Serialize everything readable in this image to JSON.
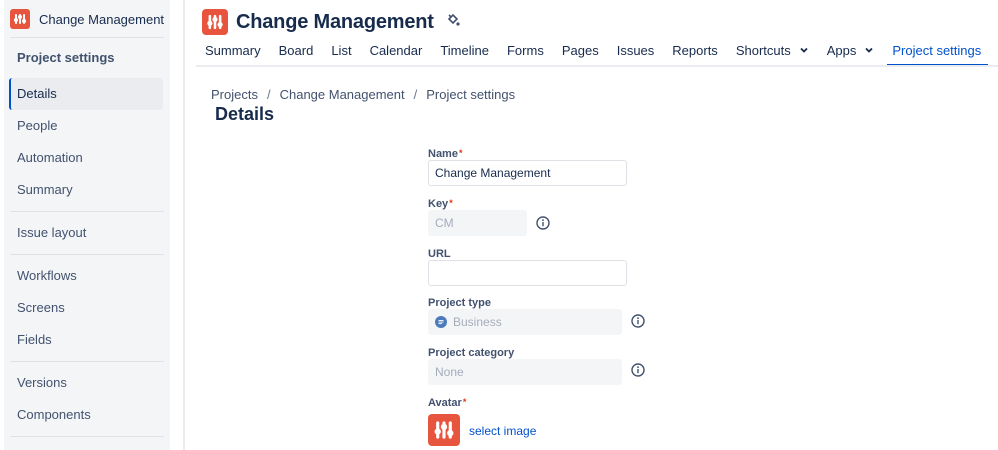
{
  "sidebar": {
    "project_name": "Change Management",
    "heading": "Project settings",
    "items": [
      {
        "label": "Details"
      },
      {
        "label": "People"
      },
      {
        "label": "Automation"
      },
      {
        "label": "Summary"
      },
      {
        "label": "Issue layout"
      },
      {
        "label": "Workflows"
      },
      {
        "label": "Screens"
      },
      {
        "label": "Fields"
      },
      {
        "label": "Versions"
      },
      {
        "label": "Components"
      }
    ]
  },
  "header": {
    "title": "Change Management",
    "tabs": [
      {
        "label": "Summary"
      },
      {
        "label": "Board"
      },
      {
        "label": "List"
      },
      {
        "label": "Calendar"
      },
      {
        "label": "Timeline"
      },
      {
        "label": "Forms"
      },
      {
        "label": "Pages"
      },
      {
        "label": "Issues"
      },
      {
        "label": "Reports"
      },
      {
        "label": "Shortcuts"
      },
      {
        "label": "Apps"
      },
      {
        "label": "Project settings"
      }
    ]
  },
  "breadcrumb": [
    "Projects",
    "Change Management",
    "Project settings"
  ],
  "page_title": "Details",
  "form": {
    "name_label": "Name",
    "name_value": "Change Management",
    "key_label": "Key",
    "key_value": "CM",
    "url_label": "URL",
    "url_value": "",
    "type_label": "Project type",
    "type_value": "Business",
    "category_label": "Project category",
    "category_value": "None",
    "avatar_label": "Avatar",
    "select_image": "select image",
    "required_mark": "*"
  },
  "colors": {
    "accent": "#0052cc",
    "logo": "#e8553e",
    "required": "#de350b"
  }
}
